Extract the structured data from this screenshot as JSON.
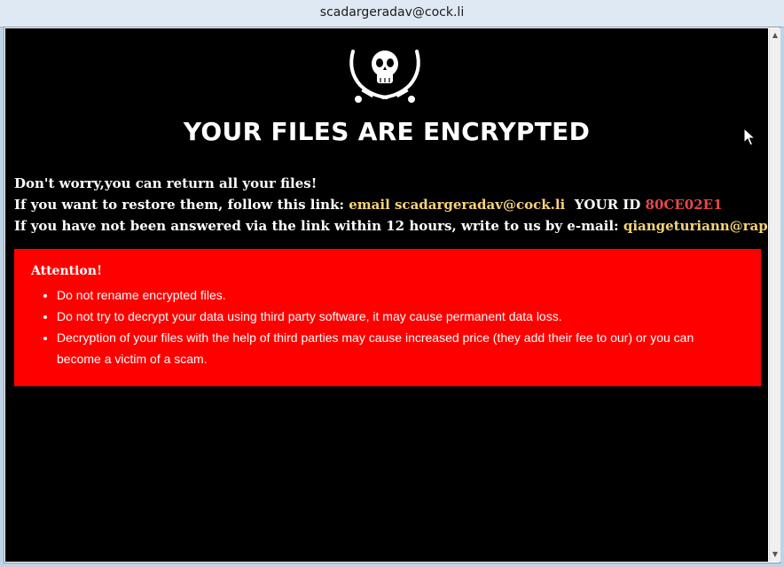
{
  "window": {
    "title": "scadargeradav@cock.li"
  },
  "note": {
    "headline": "YOUR FILES ARE ENCRYPTED",
    "line1": "Don't worry,you can return all your files!",
    "line2_prefix": "If you want to restore them, follow this link: ",
    "line2_link": "email scadargeradav@cock.li",
    "line2_id_label": "YOUR ID ",
    "line2_id_value": "80CE02E1",
    "line3_prefix": "If you have not been answered via the link within 12 hours, write to us by e-mail: ",
    "line3_email": "qiangeturiann@rape.lol"
  },
  "attention": {
    "title": "Attention!",
    "items": [
      "Do not rename encrypted files.",
      "Do not try to decrypt your data using third party software, it may cause permanent data loss.",
      "Decryption of your files with the help of third parties may cause increased price (they add their fee to our) or you can become a victim of a scam."
    ]
  },
  "colors": {
    "background": "#000000",
    "text": "#ffffff",
    "link": "#f6d27a",
    "id": "#e8484b",
    "alert_box": "#ff0000"
  },
  "icons": [
    "skull-crossed-swords-icon",
    "mouse-cursor-icon",
    "scroll-up-icon",
    "scroll-down-icon"
  ]
}
